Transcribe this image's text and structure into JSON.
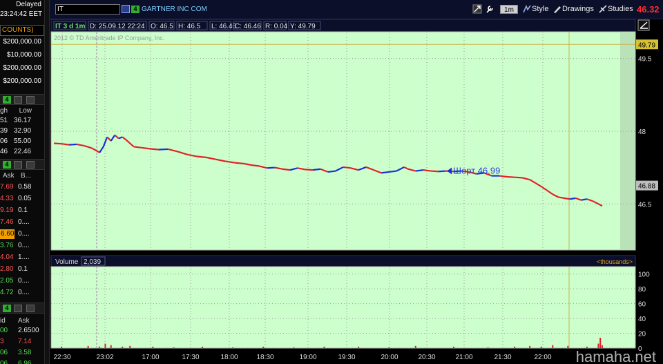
{
  "left_panel": {
    "header": {
      "delayed": "Delayed",
      "time": "23:24:42 EET"
    },
    "accounts": {
      "label": "COUNTS)",
      "balances": [
        "$200,000.00",
        "$10,000.00",
        "$200,000.00",
        "$200,000.00"
      ]
    },
    "table1": {
      "headers": [
        "gh",
        "Low"
      ],
      "rows": [
        [
          "51",
          "36.17"
        ],
        [
          "39",
          "32.90"
        ],
        [
          "06",
          "55.00"
        ],
        [
          "46",
          "22.46"
        ]
      ]
    },
    "table2": {
      "headers": [
        "Ask",
        "B..."
      ],
      "rows": [
        [
          "7.69",
          "0.58"
        ],
        [
          "4.33",
          "0.05"
        ],
        [
          "9.19",
          "0.1"
        ],
        [
          "7.46",
          "0...."
        ],
        [
          "6.60",
          "0...."
        ],
        [
          "3.76",
          "0...."
        ],
        [
          "4.04",
          "1...."
        ],
        [
          "2.80",
          "0.1"
        ],
        [
          "2.05",
          "0...."
        ],
        [
          "4.72",
          "0...."
        ]
      ]
    },
    "table3": {
      "headers": [
        "id",
        "Ask"
      ],
      "rows": [
        [
          "00",
          "2.6500"
        ],
        [
          "3",
          "7.14"
        ],
        [
          "06",
          "3.58"
        ],
        [
          "06",
          "6.96"
        ]
      ]
    },
    "toolbar_badge": "4"
  },
  "toolbar": {
    "symbol": "IT",
    "link_badge": "4",
    "company": "GARTNER INC COM",
    "period": "1m",
    "style_label": "Style",
    "drawings_label": "Drawings",
    "studies_label": "Studies",
    "last_price": "46.32"
  },
  "chart": {
    "info_bar": {
      "aggregation": "IT 3 d 1m",
      "date": "D: 25.09.12 22:24",
      "open": "O: 46.5",
      "high": "H: 46.5",
      "low": "L: 46.46",
      "close": "C: 46.46",
      "range": "R: 0.04",
      "y": "Y: 49.79"
    },
    "copyright": "2012 © TD Ameritrade IP Company, Inc.",
    "order_annotation": "Шорт 46.99",
    "volume_label": "Volume",
    "volume_value": "2,039",
    "thousands_label": "<thousands>",
    "watermark": "hamaha.net"
  },
  "chart_data": {
    "type": "line",
    "price_axis": {
      "ticks": [
        49.5,
        48,
        46.5
      ],
      "labels": [
        "49.5",
        "48",
        "46.5"
      ],
      "ylim": [
        45.55,
        50.05
      ]
    },
    "price_tags": [
      {
        "label": "49.79",
        "value": 49.79,
        "color": "#d6c230"
      },
      {
        "label": "46.88",
        "value": 46.88,
        "color": "#bdbdbd"
      }
    ],
    "volume_axis": {
      "ticks": [
        100,
        80,
        60,
        40,
        20,
        0
      ],
      "labels": [
        "100",
        "80",
        "60",
        "40",
        "20",
        "0"
      ],
      "ylim": [
        0,
        110
      ]
    },
    "time_labels": [
      "22:30",
      "23:02",
      "17:00",
      "17:30",
      "18:00",
      "18:30",
      "19:00",
      "19:30",
      "20:00",
      "20:30",
      "21:00",
      "21:30",
      "22:00"
    ],
    "price_series": [
      {
        "x": 0,
        "y": 47.75
      },
      {
        "x": 4,
        "y": 47.74
      },
      {
        "x": 8,
        "y": 47.72
      },
      {
        "x": 12,
        "y": 47.73
      },
      {
        "x": 16,
        "y": 47.7
      },
      {
        "x": 20,
        "y": 47.65
      },
      {
        "x": 24,
        "y": 47.56
      },
      {
        "x": 26,
        "y": 47.68
      },
      {
        "x": 28,
        "y": 47.88
      },
      {
        "x": 30,
        "y": 47.8
      },
      {
        "x": 32,
        "y": 47.92
      },
      {
        "x": 34,
        "y": 47.85
      },
      {
        "x": 36,
        "y": 47.88
      },
      {
        "x": 38,
        "y": 47.82
      },
      {
        "x": 40,
        "y": 47.75
      },
      {
        "x": 42,
        "y": 47.68
      },
      {
        "x": 46,
        "y": 47.66
      },
      {
        "x": 50,
        "y": 47.64
      },
      {
        "x": 55,
        "y": 47.62
      },
      {
        "x": 60,
        "y": 47.63
      },
      {
        "x": 65,
        "y": 47.58
      },
      {
        "x": 70,
        "y": 47.52
      },
      {
        "x": 75,
        "y": 47.48
      },
      {
        "x": 80,
        "y": 47.46
      },
      {
        "x": 85,
        "y": 47.42
      },
      {
        "x": 90,
        "y": 47.38
      },
      {
        "x": 95,
        "y": 47.35
      },
      {
        "x": 100,
        "y": 47.33
      },
      {
        "x": 104,
        "y": 47.3
      },
      {
        "x": 108,
        "y": 47.28
      },
      {
        "x": 112,
        "y": 47.24
      },
      {
        "x": 116,
        "y": 47.25
      },
      {
        "x": 120,
        "y": 47.22
      },
      {
        "x": 124,
        "y": 47.2
      },
      {
        "x": 128,
        "y": 47.24
      },
      {
        "x": 132,
        "y": 47.21
      },
      {
        "x": 136,
        "y": 47.2
      },
      {
        "x": 140,
        "y": 47.22
      },
      {
        "x": 144,
        "y": 47.16
      },
      {
        "x": 148,
        "y": 47.18
      },
      {
        "x": 152,
        "y": 47.26
      },
      {
        "x": 156,
        "y": 47.24
      },
      {
        "x": 160,
        "y": 47.2
      },
      {
        "x": 164,
        "y": 47.26
      },
      {
        "x": 168,
        "y": 47.2
      },
      {
        "x": 172,
        "y": 47.14
      },
      {
        "x": 176,
        "y": 47.16
      },
      {
        "x": 180,
        "y": 47.18
      },
      {
        "x": 184,
        "y": 47.26
      },
      {
        "x": 186,
        "y": 47.22
      },
      {
        "x": 190,
        "y": 47.18
      },
      {
        "x": 194,
        "y": 47.2
      },
      {
        "x": 198,
        "y": 47.18
      },
      {
        "x": 202,
        "y": 47.17
      },
      {
        "x": 206,
        "y": 47.18
      },
      {
        "x": 210,
        "y": 47.17
      },
      {
        "x": 214,
        "y": 47.18
      },
      {
        "x": 218,
        "y": 47.16
      },
      {
        "x": 222,
        "y": 47.12
      },
      {
        "x": 226,
        "y": 47.14
      },
      {
        "x": 230,
        "y": 47.08
      },
      {
        "x": 234,
        "y": 47.08
      },
      {
        "x": 238,
        "y": 47.06
      },
      {
        "x": 242,
        "y": 47.05
      },
      {
        "x": 246,
        "y": 47.04
      },
      {
        "x": 250,
        "y": 47.0
      },
      {
        "x": 253,
        "y": 46.93
      },
      {
        "x": 256,
        "y": 46.86
      },
      {
        "x": 259,
        "y": 46.78
      },
      {
        "x": 262,
        "y": 46.7
      },
      {
        "x": 265,
        "y": 46.64
      },
      {
        "x": 268,
        "y": 46.62
      },
      {
        "x": 271,
        "y": 46.6
      },
      {
        "x": 274,
        "y": 46.62
      },
      {
        "x": 277,
        "y": 46.58
      },
      {
        "x": 280,
        "y": 46.6
      },
      {
        "x": 283,
        "y": 46.56
      },
      {
        "x": 286,
        "y": 46.5
      },
      {
        "x": 288,
        "y": 46.46
      }
    ],
    "volume_x": [
      4,
      18,
      24,
      27,
      30,
      36,
      40,
      52,
      63,
      78,
      94,
      110,
      126,
      142,
      160,
      176,
      190,
      210,
      228,
      242,
      250,
      256,
      262,
      270,
      280,
      286,
      287,
      288
    ],
    "volume_values": [
      2,
      3,
      2,
      6,
      4,
      2,
      3,
      2,
      1,
      2,
      1,
      2,
      1,
      2,
      2,
      1,
      3,
      2,
      1,
      2,
      3,
      2,
      4,
      3,
      2,
      6,
      14,
      4
    ],
    "x_range": [
      0,
      296
    ],
    "order_marker": {
      "x": 209,
      "y": 47.18
    }
  }
}
